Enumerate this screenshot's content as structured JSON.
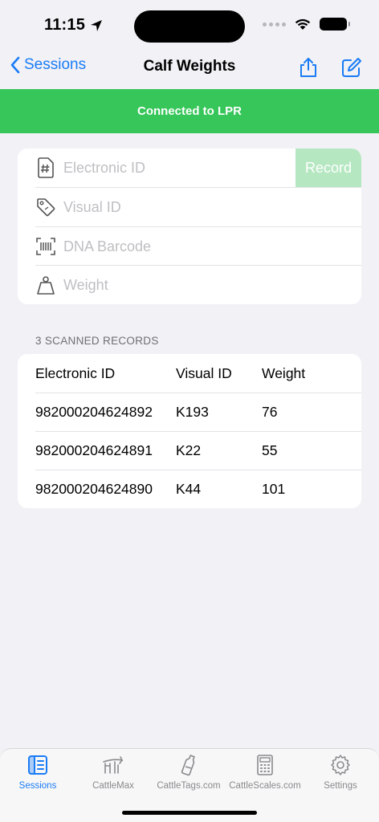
{
  "status": {
    "time": "11:15"
  },
  "nav": {
    "back_label": "Sessions",
    "title": "Calf Weights"
  },
  "banner": {
    "text": "Connected to LPR",
    "color": "#36c659"
  },
  "form": {
    "electronic_id_placeholder": "Electronic ID",
    "visual_id_placeholder": "Visual ID",
    "dna_barcode_placeholder": "DNA Barcode",
    "weight_placeholder": "Weight",
    "record_label": "Record"
  },
  "records": {
    "section_title": "3 SCANNED RECORDS",
    "columns": [
      "Electronic ID",
      "Visual ID",
      "Weight"
    ],
    "rows": [
      [
        "982000204624892",
        "K193",
        "76"
      ],
      [
        "982000204624891",
        "K22",
        "55"
      ],
      [
        "982000204624890",
        "K44",
        "101"
      ]
    ]
  },
  "tabs": [
    {
      "label": "Sessions",
      "icon": "sessions-icon",
      "active": true
    },
    {
      "label": "CattleMax",
      "icon": "cattlemax-icon",
      "active": false
    },
    {
      "label": "CattleTags.com",
      "icon": "tag-bottle-icon",
      "active": false
    },
    {
      "label": "CattleScales.com",
      "icon": "scale-calculator-icon",
      "active": false
    },
    {
      "label": "Settings",
      "icon": "gear-icon",
      "active": false
    }
  ],
  "colors": {
    "accent": "#1a7cf5",
    "record_button": "#b5e7c1"
  }
}
